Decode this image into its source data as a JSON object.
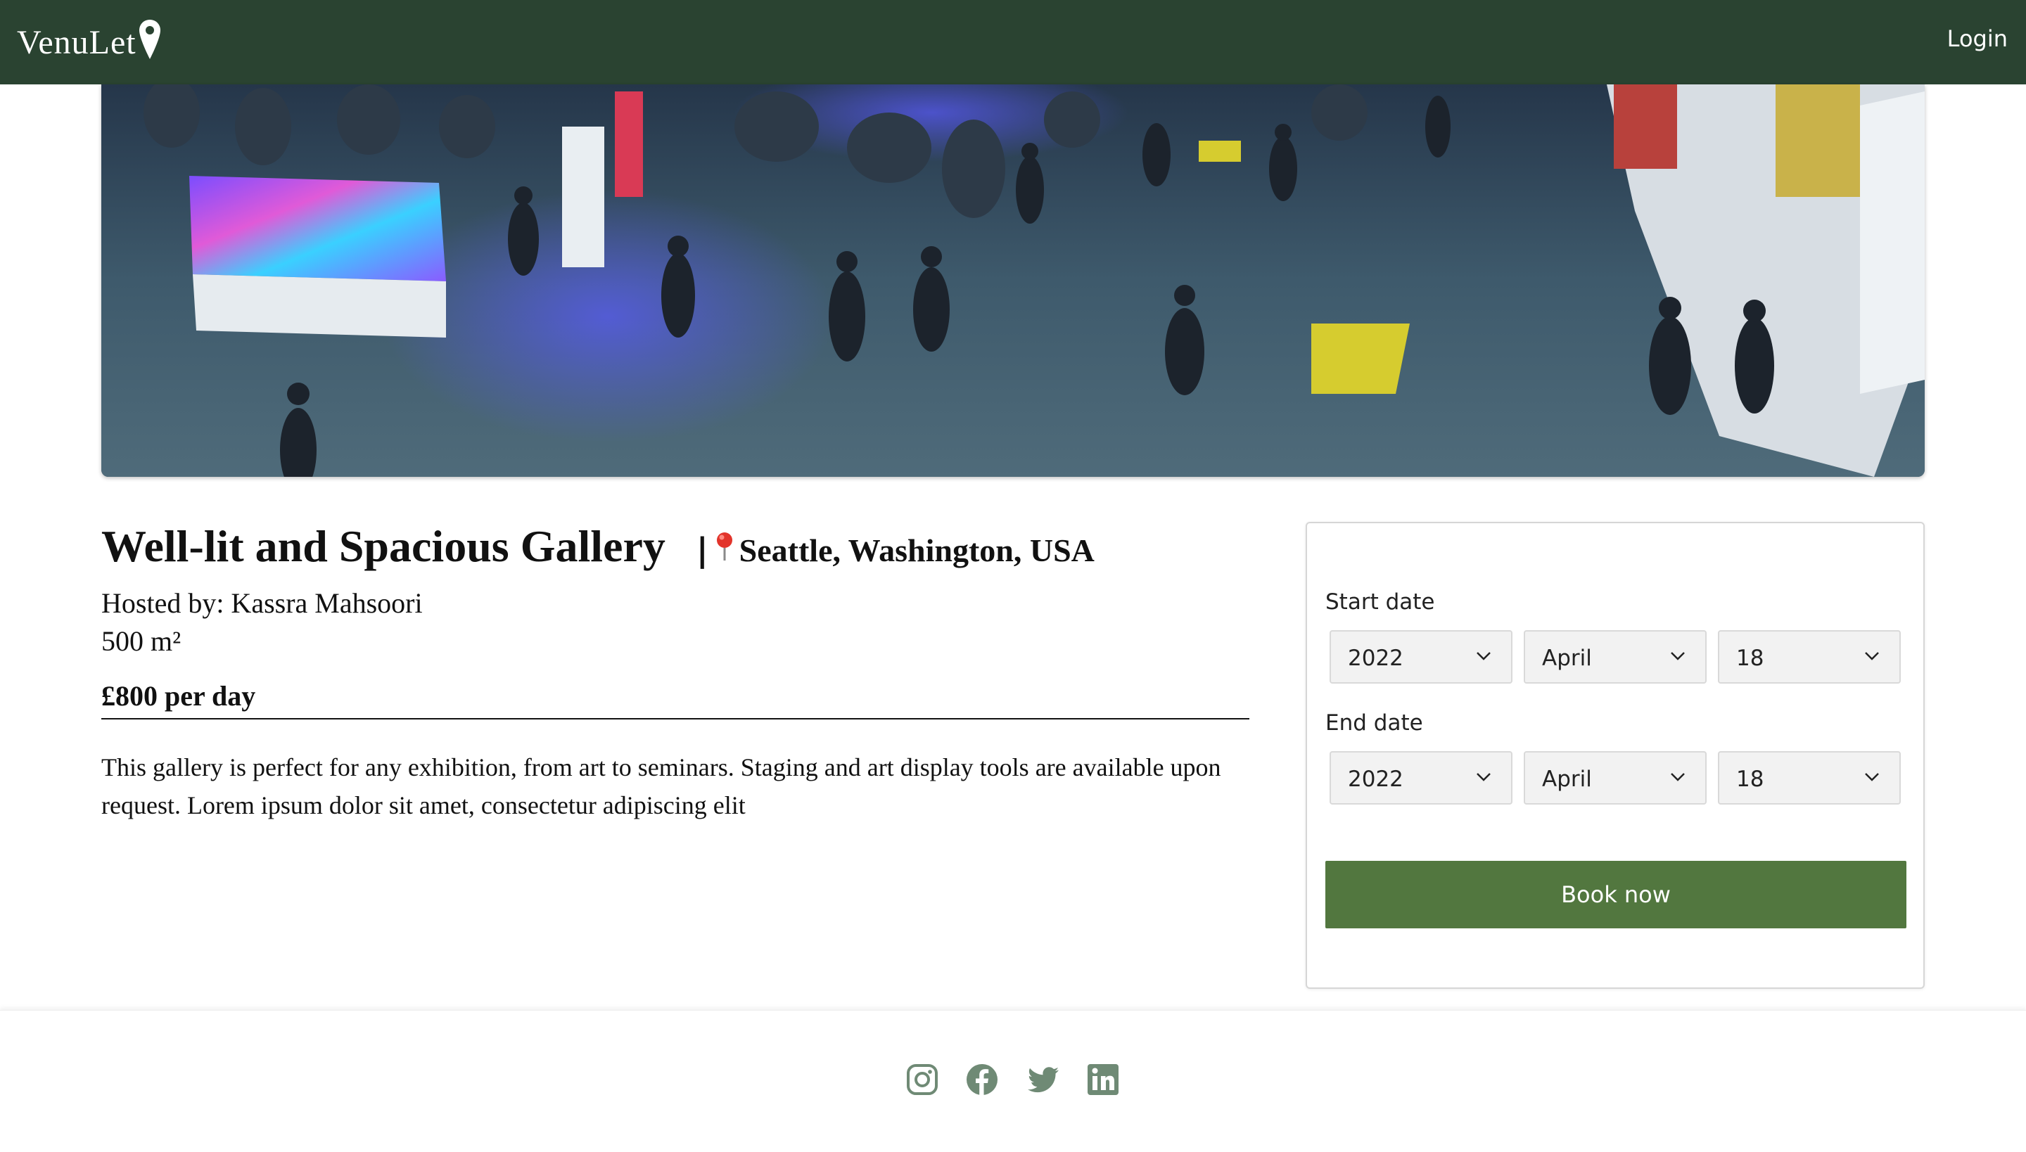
{
  "header": {
    "logo_text": "VenuLet",
    "login_label": "Login",
    "background_color": "#2a4331"
  },
  "hero": {
    "icon": "venue-photo"
  },
  "venue": {
    "title": "Well-lit and Spacious Gallery",
    "separator": "|",
    "location_icon": "pin-icon",
    "location": "Seattle, Washington, USA",
    "host": "Hosted by: Kassra Mahsoori",
    "area": "500 m²",
    "price": "£800 per day",
    "description": "This gallery is perfect for any exhibition, from art to seminars. Staging and art display tools are available upon request. Lorem ipsum dolor sit amet, consectetur adipiscing elit"
  },
  "booking": {
    "start_label": "Start date",
    "start_year": "2022",
    "start_month": "April",
    "start_day": "18",
    "end_label": "End date",
    "end_year": "2022",
    "end_month": "April",
    "end_day": "18",
    "book_label": "Book now",
    "button_color": "#52773f"
  },
  "footer": {
    "icons": [
      "instagram-icon",
      "facebook-icon",
      "twitter-icon",
      "linkedin-icon"
    ],
    "icon_color": "#6f8a75"
  }
}
